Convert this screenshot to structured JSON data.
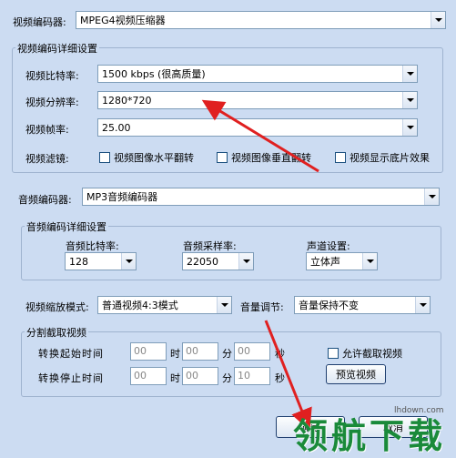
{
  "video_codec": {
    "label": "视频编码器:",
    "value": "MPEG4视频压缩器"
  },
  "video_detail": {
    "title": "视频编码详细设置",
    "bitrate": {
      "label": "视频比特率:",
      "value": "1500 kbps (很高质量)"
    },
    "resolution": {
      "label": "视频分辨率:",
      "value": "1280*720"
    },
    "framerate": {
      "label": "视频帧率:",
      "value": "25.00"
    },
    "filter": {
      "label": "视频滤镜:",
      "options": [
        "视频图像水平翻转",
        "视频图像垂直翻转",
        "视频显示底片效果"
      ]
    }
  },
  "audio_codec": {
    "label": "音频编码器:",
    "value": "MP3音频编码器"
  },
  "audio_detail": {
    "title": "音频编码详细设置",
    "bitrate": {
      "label": "音频比特率:",
      "value": "128"
    },
    "samplerate": {
      "label": "音频采样率:",
      "value": "22050"
    },
    "channel": {
      "label": "声道设置:",
      "value": "立体声"
    }
  },
  "scale_mode": {
    "label": "视频缩放模式:",
    "value": "普通视频4:3模式"
  },
  "volume": {
    "label": "音量调节:",
    "value": "音量保持不变"
  },
  "split": {
    "title": "分割截取视频",
    "start_label": "转换起始时间",
    "end_label": "转换停止时间",
    "hour": "时",
    "minute": "分",
    "second": "秒",
    "start": {
      "h": "00",
      "m": "00",
      "s": "00"
    },
    "end": {
      "h": "00",
      "m": "00",
      "s": "10"
    },
    "allow_label": "允许截取视频",
    "preview_button": "预览视频"
  },
  "buttons": {
    "ok": "确定",
    "cancel": "取消"
  },
  "watermark": {
    "text": "领航下载",
    "site": "lhdown.com"
  }
}
